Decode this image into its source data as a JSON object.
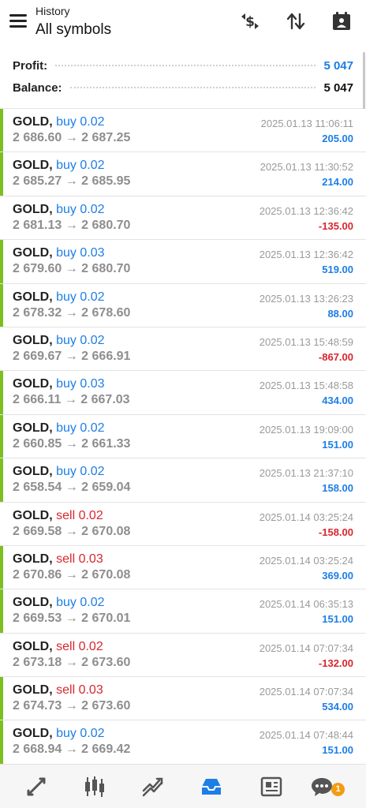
{
  "header": {
    "subtitle": "History",
    "title": "All symbols"
  },
  "summary": {
    "profit_label": "Profit:",
    "profit_value": "5 047",
    "balance_label": "Balance:",
    "balance_value": "5 047",
    "profit_color": "#1d7ee6"
  },
  "deals": [
    {
      "symbol": "GOLD,",
      "side": "buy 0.02",
      "prices": "2 686.60 → 2 687.25",
      "time": "2025.01.13 11:06:11",
      "pl": "205.00"
    },
    {
      "symbol": "GOLD,",
      "side": "buy 0.02",
      "prices": "2 685.27 → 2 685.95",
      "time": "2025.01.13 11:30:52",
      "pl": "214.00"
    },
    {
      "symbol": "GOLD,",
      "side": "buy 0.02",
      "prices": "2 681.13 → 2 680.70",
      "time": "2025.01.13 12:36:42",
      "pl": "-135.00"
    },
    {
      "symbol": "GOLD,",
      "side": "buy 0.03",
      "prices": "2 679.60 → 2 680.70",
      "time": "2025.01.13 12:36:42",
      "pl": "519.00"
    },
    {
      "symbol": "GOLD,",
      "side": "buy 0.02",
      "prices": "2 678.32 → 2 678.60",
      "time": "2025.01.13 13:26:23",
      "pl": "88.00"
    },
    {
      "symbol": "GOLD,",
      "side": "buy 0.02",
      "prices": "2 669.67 → 2 666.91",
      "time": "2025.01.13 15:48:59",
      "pl": "-867.00"
    },
    {
      "symbol": "GOLD,",
      "side": "buy 0.03",
      "prices": "2 666.11 → 2 667.03",
      "time": "2025.01.13 15:48:58",
      "pl": "434.00"
    },
    {
      "symbol": "GOLD,",
      "side": "buy 0.02",
      "prices": "2 660.85 → 2 661.33",
      "time": "2025.01.13 19:09:00",
      "pl": "151.00"
    },
    {
      "symbol": "GOLD,",
      "side": "buy 0.02",
      "prices": "2 658.54 → 2 659.04",
      "time": "2025.01.13 21:37:10",
      "pl": "158.00"
    },
    {
      "symbol": "GOLD,",
      "side": "sell 0.02",
      "prices": "2 669.58 → 2 670.08",
      "time": "2025.01.14 03:25:24",
      "pl": "-158.00"
    },
    {
      "symbol": "GOLD,",
      "side": "sell 0.03",
      "prices": "2 670.86 → 2 670.08",
      "time": "2025.01.14 03:25:24",
      "pl": "369.00"
    },
    {
      "symbol": "GOLD,",
      "side": "buy 0.02",
      "prices": "2 669.53 → 2 670.01",
      "time": "2025.01.14 06:35:13",
      "pl": "151.00"
    },
    {
      "symbol": "GOLD,",
      "side": "sell 0.02",
      "prices": "2 673.18 → 2 673.60",
      "time": "2025.01.14 07:07:34",
      "pl": "-132.00"
    },
    {
      "symbol": "GOLD,",
      "side": "sell 0.03",
      "prices": "2 674.73 → 2 673.60",
      "time": "2025.01.14 07:07:34",
      "pl": "534.00"
    },
    {
      "symbol": "GOLD,",
      "side": "buy 0.02",
      "prices": "2 668.94 → 2 669.42",
      "time": "2025.01.14 07:48:44",
      "pl": "151.00"
    }
  ],
  "toolbar_icons": [
    "deposit-withdraw-icon",
    "sort-icon",
    "calendar-icon"
  ],
  "nav": {
    "items": [
      "quotes-icon",
      "chart-icon",
      "trade-icon",
      "history-icon",
      "news-icon",
      "messages-icon"
    ],
    "active": "history-icon",
    "active_color": "#1d7ee6",
    "badge": "1"
  },
  "colors": {
    "accent": "#1d7ee6",
    "loss": "#d8262e",
    "profit_bar": "#7cbf1f"
  }
}
